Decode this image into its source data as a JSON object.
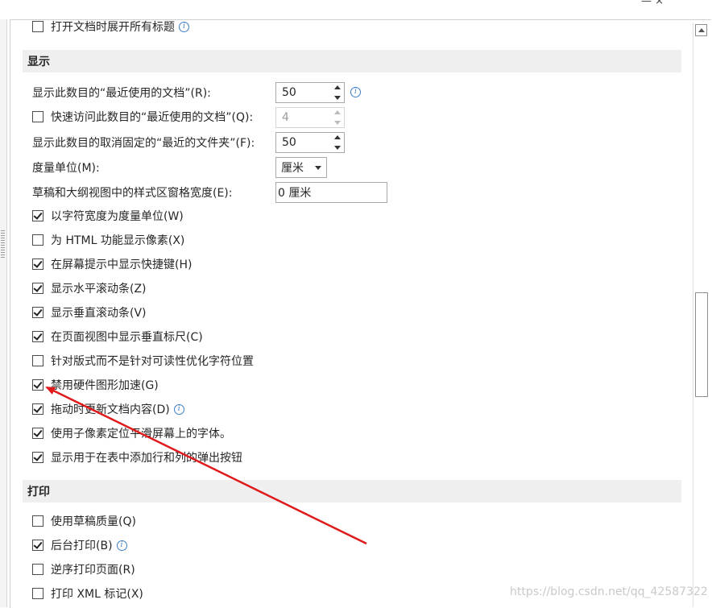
{
  "top": {
    "text_right": "—   ×"
  },
  "options_above": [
    {
      "label": "打开文档时展开所有标题",
      "checked": false,
      "info": true
    }
  ],
  "sections": {
    "display": {
      "title": "显示"
    },
    "print": {
      "title": "打印"
    }
  },
  "display_fields": {
    "recent_docs_label": "显示此数目的“最近使用的文档”(R):",
    "recent_docs_value": "50",
    "quick_access_label": "快速访问此数目的“最近使用的文档”(Q):",
    "quick_access_value": "4",
    "unpinned_folders_label": "显示此数目的取消固定的“最近的文件夹”(F):",
    "unpinned_folders_value": "50",
    "units_label": "度量单位(M):",
    "units_value": "厘米",
    "style_width_label": "草稿和大纲视图中的样式区窗格宽度(E):",
    "style_width_value": "0 厘米"
  },
  "display_checks": [
    {
      "label": "以字符宽度为度量单位(W)",
      "checked": true
    },
    {
      "label": "为 HTML 功能显示像素(X)",
      "checked": false
    },
    {
      "label": "在屏幕提示中显示快捷键(H)",
      "checked": true
    },
    {
      "label": "显示水平滚动条(Z)",
      "checked": true
    },
    {
      "label": "显示垂直滚动条(V)",
      "checked": true
    },
    {
      "label": "在页面视图中显示垂直标尺(C)",
      "checked": true
    },
    {
      "label": "针对版式而不是针对可读性优化字符位置",
      "checked": false
    },
    {
      "label": "禁用硬件图形加速(G)",
      "checked": true
    },
    {
      "label": "拖动时更新文档内容(D)",
      "checked": true,
      "info": true
    },
    {
      "label": "使用子像素定位平滑屏幕上的字体。",
      "checked": true
    },
    {
      "label": "显示用于在表中添加行和列的弹出按钮",
      "checked": true
    }
  ],
  "print_checks": [
    {
      "label": "使用草稿质量(Q)",
      "checked": false
    },
    {
      "label": "后台打印(B)",
      "checked": true,
      "info": true
    },
    {
      "label": "逆序打印页面(R)",
      "checked": false
    },
    {
      "label": "打印 XML 标记(X)",
      "checked": false
    }
  ],
  "watermark": "https://blog.csdn.net/qq_42587322",
  "colors": {
    "arrow": "#e0191a",
    "info_icon": "#3a7fc7",
    "section_bg": "#efefef"
  }
}
